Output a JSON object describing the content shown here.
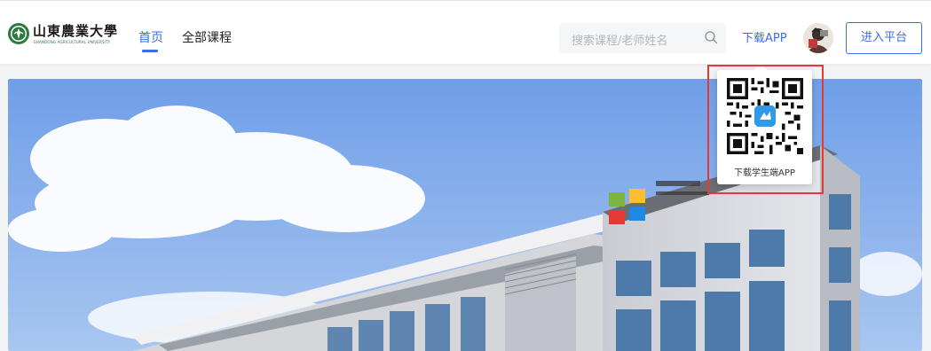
{
  "header": {
    "logo": {
      "name_cn": "山東農業大學",
      "name_en": "SHANDONG AGRICULTURAL UNIVERSITY"
    },
    "nav": [
      {
        "label": "首页",
        "active": true
      },
      {
        "label": "全部课程",
        "active": false
      }
    ],
    "search": {
      "placeholder": "搜索课程/老师姓名",
      "icon": "search-icon"
    },
    "download_label": "下载APP",
    "enter_button": "进入平台"
  },
  "qr_popup": {
    "caption": "下载学生端APP"
  },
  "colors": {
    "accent": "#3a6ee8",
    "highlight": "#e53935"
  }
}
